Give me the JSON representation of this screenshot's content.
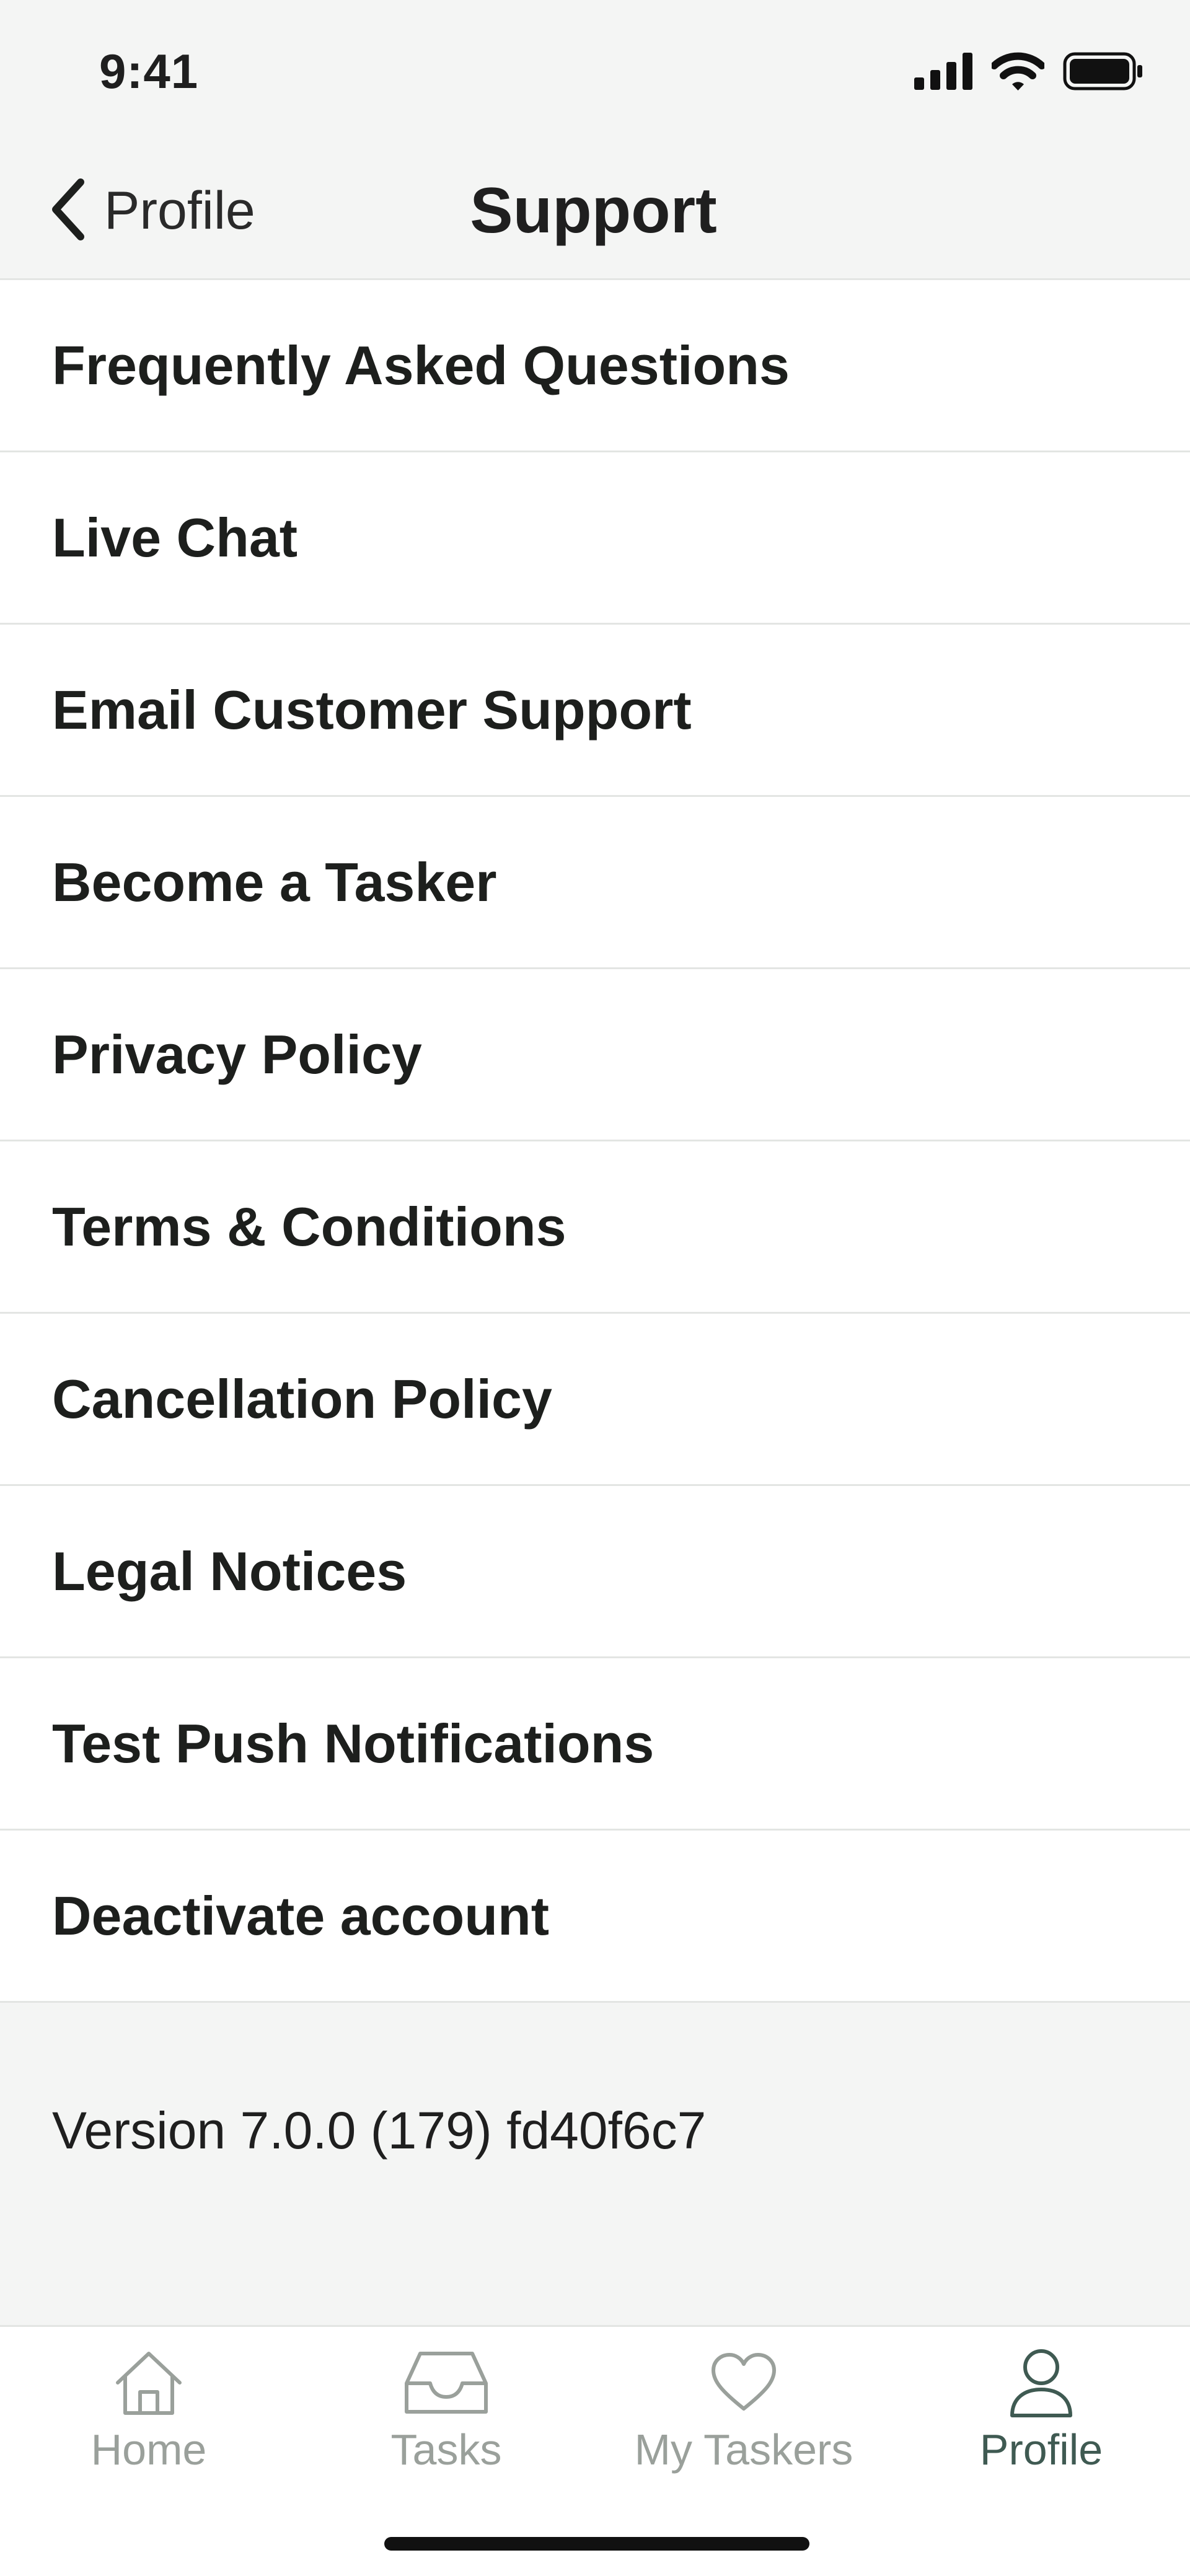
{
  "status_bar": {
    "time": "9:41",
    "icons": [
      "signal-icon",
      "wifi-icon",
      "battery-icon"
    ]
  },
  "nav": {
    "back_label": "Profile",
    "title": "Support"
  },
  "menu": {
    "items": [
      "Frequently Asked Questions",
      "Live Chat",
      "Email Customer Support",
      "Become a Tasker",
      "Privacy Policy",
      "Terms & Conditions",
      "Cancellation Policy",
      "Legal Notices",
      "Test Push Notifications",
      "Deactivate account"
    ]
  },
  "version_text": "Version 7.0.0 (179) fd40f6c7",
  "tab_bar": {
    "tabs": [
      {
        "label": "Home",
        "icon": "home-icon",
        "active": false
      },
      {
        "label": "Tasks",
        "icon": "inbox-icon",
        "active": false
      },
      {
        "label": "My Taskers",
        "icon": "heart-icon",
        "active": false
      },
      {
        "label": "Profile",
        "icon": "person-icon",
        "active": true
      }
    ]
  },
  "colors": {
    "background": "#f4f5f4",
    "surface": "#ffffff",
    "divider": "#e3e5e3",
    "text": "#1d1f1d",
    "tab_inactive": "#9aa09b",
    "tab_active": "#3f5a52"
  }
}
